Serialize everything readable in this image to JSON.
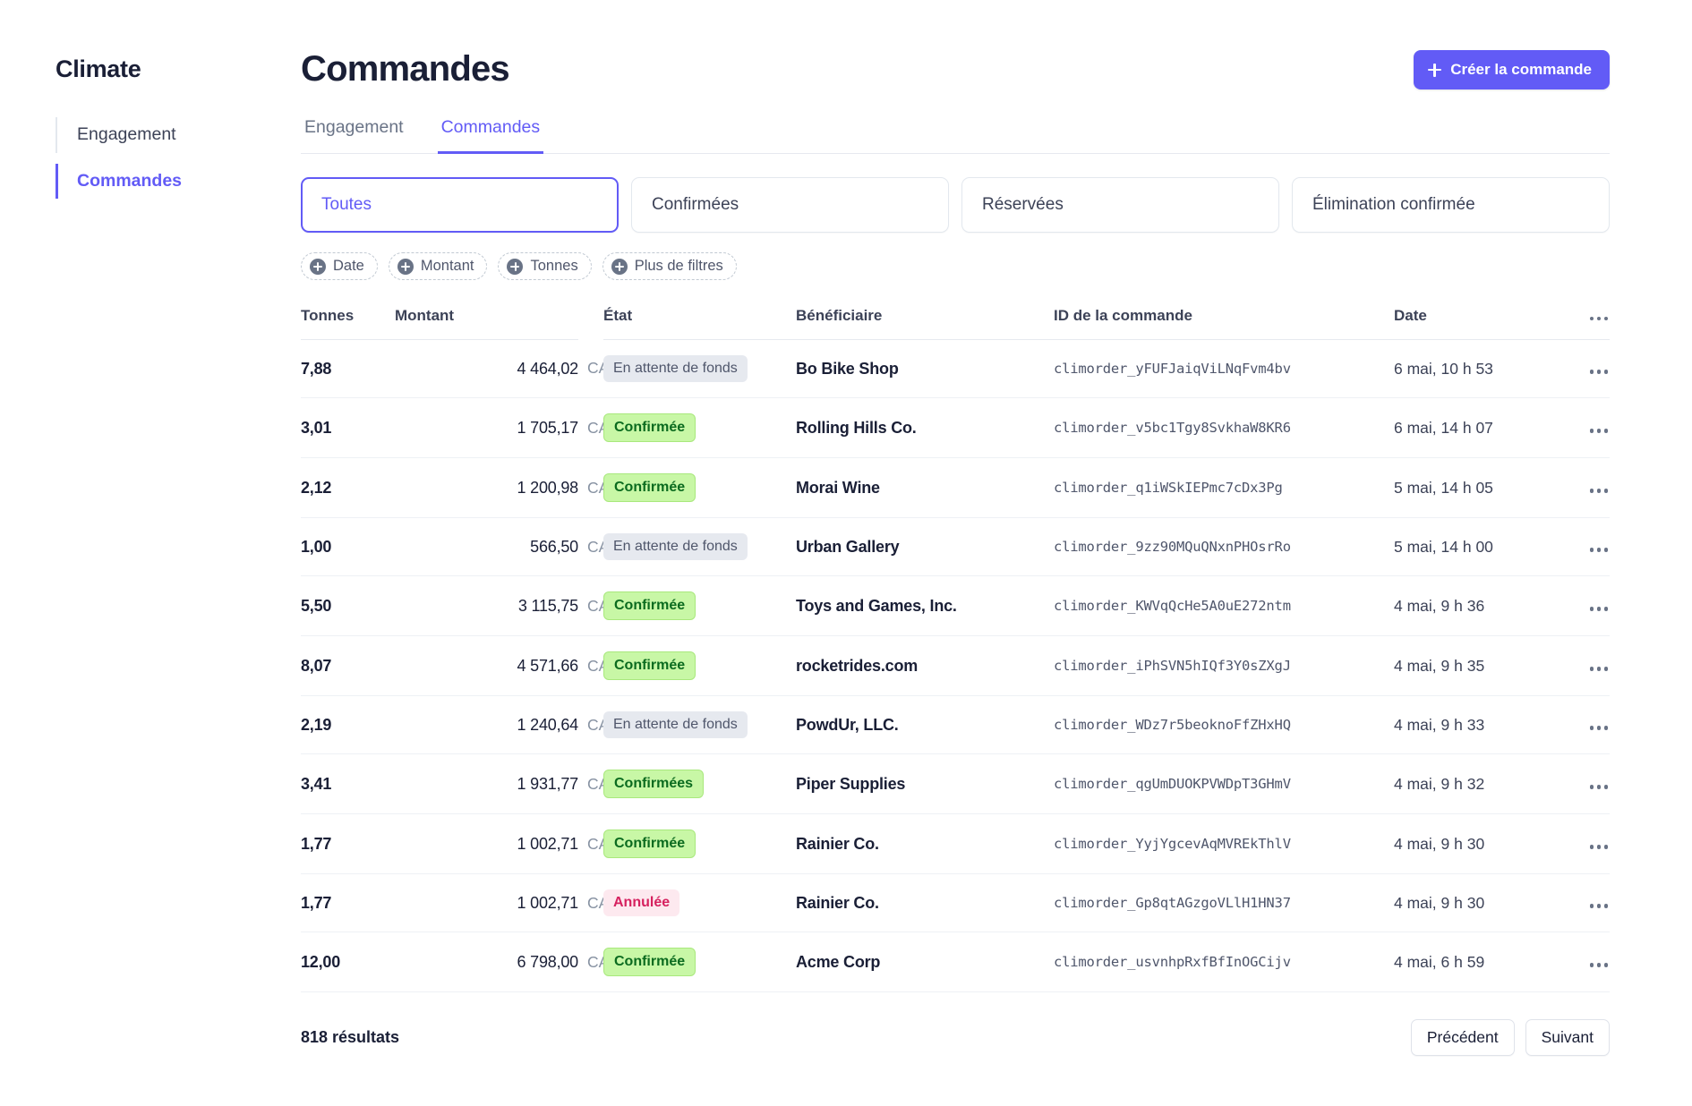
{
  "sidebar": {
    "brand": "Climate",
    "items": [
      {
        "label": "Engagement",
        "active": false
      },
      {
        "label": "Commandes",
        "active": true
      }
    ]
  },
  "header": {
    "title": "Commandes",
    "create_button": "Créer la commande",
    "create_icon": "plus-icon"
  },
  "tabs": [
    {
      "label": "Engagement",
      "active": false
    },
    {
      "label": "Commandes",
      "active": true
    }
  ],
  "filter_cards": [
    {
      "label": "Toutes",
      "active": true
    },
    {
      "label": "Confirmées",
      "active": false
    },
    {
      "label": "Réservées",
      "active": false
    },
    {
      "label": "Élimination confirmée",
      "active": false
    }
  ],
  "filter_chips": [
    {
      "label": "Date",
      "icon": "plus-circle-icon"
    },
    {
      "label": "Montant",
      "icon": "plus-circle-icon"
    },
    {
      "label": "Tonnes",
      "icon": "plus-circle-icon"
    },
    {
      "label": "Plus de filtres",
      "icon": "plus-circle-icon"
    }
  ],
  "table": {
    "columns": {
      "tonnes": "Tonnes",
      "montant": "Montant",
      "etat": "État",
      "beneficiaire": "Bénéficiaire",
      "order_id": "ID de la commande",
      "date": "Date",
      "actions": "overflow-menu-icon"
    },
    "rows": [
      {
        "tonnes": "7,88",
        "amount": "4 464,02",
        "currency": "CAD",
        "status": "En attente de fonds",
        "status_type": "pending",
        "beneficiary": "Bo Bike Shop",
        "order_id": "climorder_yFUFJaiqViLNqFvm4bv",
        "date": "6 mai, 10 h 53"
      },
      {
        "tonnes": "3,01",
        "amount": "1 705,17",
        "currency": "CAD",
        "status": "Confirmée",
        "status_type": "confirmed",
        "beneficiary": "Rolling Hills Co.",
        "order_id": "climorder_v5bc1Tgy8SvkhaW8KR6",
        "date": "6 mai, 14 h 07"
      },
      {
        "tonnes": "2,12",
        "amount": "1 200,98",
        "currency": "CAD",
        "status": "Confirmée",
        "status_type": "confirmed",
        "beneficiary": "Morai Wine",
        "order_id": "climorder_q1iWSkIEPmc7cDx3Pg",
        "date": "5 mai, 14 h 05"
      },
      {
        "tonnes": "1,00",
        "amount": "566,50",
        "currency": "CAD",
        "status": "En attente de fonds",
        "status_type": "pending",
        "beneficiary": "Urban Gallery",
        "order_id": "climorder_9zz90MQuQNxnPHOsrRo",
        "date": "5 mai, 14 h 00"
      },
      {
        "tonnes": "5,50",
        "amount": "3 115,75",
        "currency": "CAD",
        "status": "Confirmée",
        "status_type": "confirmed",
        "beneficiary": "Toys and Games, Inc.",
        "order_id": "climorder_KWVqQcHe5A0uE272ntm",
        "date": "4 mai, 9 h 36"
      },
      {
        "tonnes": "8,07",
        "amount": "4 571,66",
        "currency": "CAD",
        "status": "Confirmée",
        "status_type": "confirmed",
        "beneficiary": "rocketrides.com",
        "order_id": "climorder_iPhSVN5hIQf3Y0sZXgJ",
        "date": "4 mai, 9 h 35"
      },
      {
        "tonnes": "2,19",
        "amount": "1 240,64",
        "currency": "CAD",
        "status": "En attente de fonds",
        "status_type": "pending",
        "beneficiary": "PowdUr, LLC.",
        "order_id": "climorder_WDz7r5beoknoFfZHxHQ",
        "date": "4 mai, 9 h 33"
      },
      {
        "tonnes": "3,41",
        "amount": "1 931,77",
        "currency": "CAD",
        "status": "Confirmées",
        "status_type": "confirmed",
        "beneficiary": "Piper Supplies",
        "order_id": "climorder_qgUmDUOKPVWDpT3GHmV",
        "date": "4 mai, 9 h 32"
      },
      {
        "tonnes": "1,77",
        "amount": "1 002,71",
        "currency": "CAD",
        "status": "Confirmée",
        "status_type": "confirmed",
        "beneficiary": "Rainier Co.",
        "order_id": "climorder_YyjYgcevAqMVREkThlV",
        "date": "4 mai, 9 h 30"
      },
      {
        "tonnes": "1,77",
        "amount": "1 002,71",
        "currency": "CAD",
        "status": "Annulée",
        "status_type": "cancelled",
        "beneficiary": "Rainier Co.",
        "order_id": "climorder_Gp8qtAGzgoVLlH1HN37",
        "date": "4 mai, 9 h 30"
      },
      {
        "tonnes": "12,00",
        "amount": "6 798,00",
        "currency": "CAD",
        "status": "Confirmée",
        "status_type": "confirmed",
        "beneficiary": "Acme Corp",
        "order_id": "climorder_usvnhpRxfBfInOGCijv",
        "date": "4 mai, 6 h 59"
      }
    ]
  },
  "footer": {
    "results": "818 résultats",
    "previous": "Précédent",
    "next": "Suivant"
  },
  "colors": {
    "accent": "#625bf6",
    "confirmed_bg": "#c8f7a6",
    "confirmed_text": "#0b6b1f",
    "pending_bg": "#e6e9ef",
    "cancelled_bg": "#fde9ef",
    "cancelled_text": "#d6215f"
  }
}
